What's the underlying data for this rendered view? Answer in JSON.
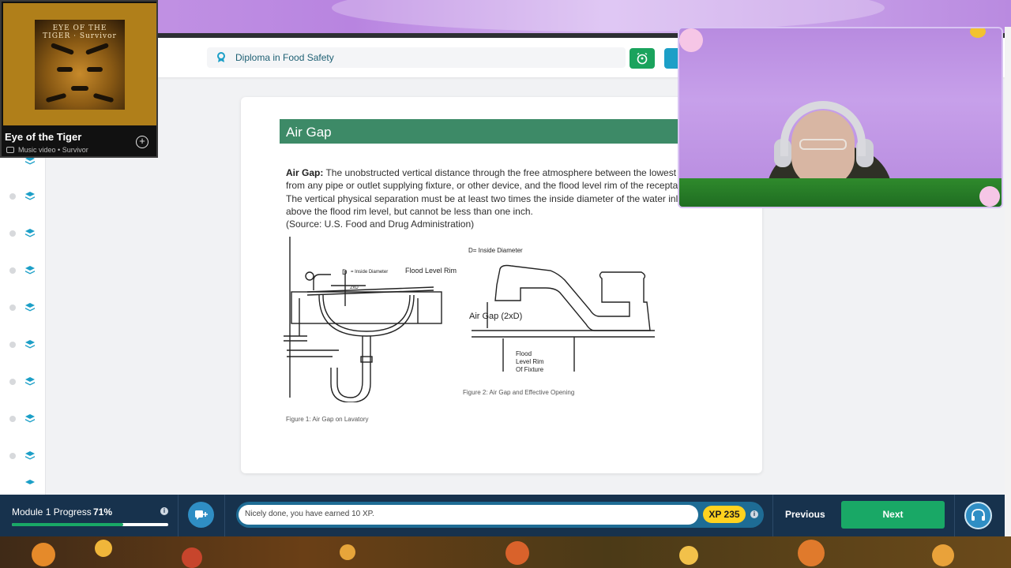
{
  "music_player": {
    "song_title": "Eye of the Tiger",
    "media_type": "Music video",
    "artist": "Survivor",
    "album_art_text": "EYE OF THE TIGER · Survivor"
  },
  "header": {
    "course_title": "Diploma in Food Safety"
  },
  "sidebar": {
    "item_count": 10
  },
  "content": {
    "section_title": "Air Gap",
    "definition_term": "Air Gap:",
    "lines": [
      " The unobstructed vertical distance through the free atmosphere between the lowest op",
      "from any pipe or outlet supplying fixture, or other device, and the flood level rim of the receptacle",
      "The vertical physical separation must be at least two times the inside diameter of the water inle",
      "above the flood rim level, but cannot be less than one inch.",
      "(Source: U.S. Food and Drug Administration)"
    ],
    "figure1": {
      "label_d": "D",
      "label_inside_diameter": "= Inside Diameter",
      "label_flood_rim": "Flood Level Rim",
      "label_2xd": "2xD",
      "caption": "Figure 1: Air Gap on Lavatory"
    },
    "figure2": {
      "label_d_inside": "D= Inside Diameter",
      "label_air_gap": "Air Gap (2xD)",
      "label_flood_1": "Flood",
      "label_flood_2": "Level Rim",
      "label_flood_3": "Of Fixture",
      "caption": "Figure 2: Air Gap and Effective Opening"
    }
  },
  "bottom_bar": {
    "progress_label": "Module 1 Progress",
    "progress_percent_text": "71%",
    "progress_fraction": 0.71,
    "message": "Nicely done, you have earned 10 XP.",
    "xp_text": "XP 235",
    "previous_label": "Previous",
    "next_label": "Next"
  },
  "colors": {
    "section_header": "#3d8a67",
    "next_button": "#19a866",
    "bottom_bar": "#17324d",
    "xp_badge": "#ffd21f",
    "course_title": "#1d5f73"
  }
}
